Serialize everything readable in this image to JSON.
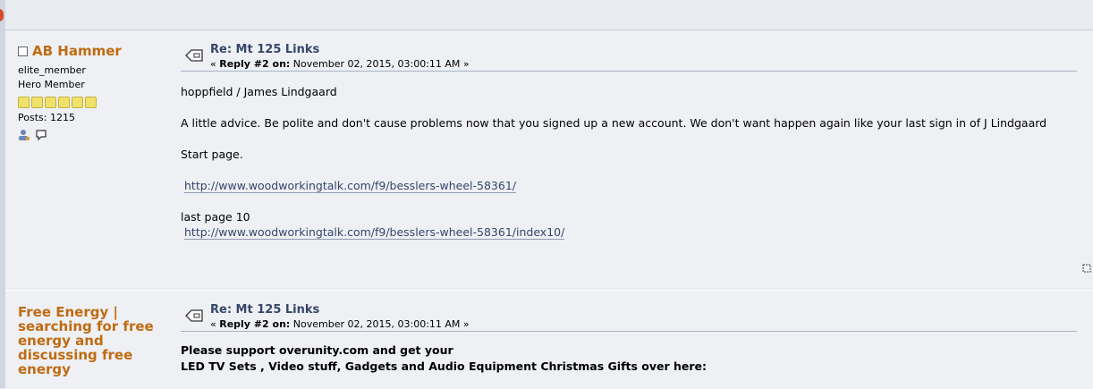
{
  "post1": {
    "username": "AB Hammer",
    "group": "elite_member",
    "rank": "Hero Member",
    "posts": "Posts: 1215",
    "title": "Re: Mt 125 Links",
    "reply_label": "Reply #2 on:",
    "reply_prefix": "«",
    "reply_suffix": "»",
    "date": "November 02, 2015, 03:00:11 AM",
    "line1": "hoppfield / James Lindgaard",
    "line2": "A little advice. Be polite and don't cause problems now that you signed up a new account. We don't want happen again like your last sign in of J Lindgaard",
    "line3": "Start page.",
    "link1": "http://www.woodworkingtalk.com/f9/besslers-wheel-58361/",
    "line4": "last page 10",
    "link2": "http://www.woodworkingtalk.com/f9/besslers-wheel-58361/index10/"
  },
  "post2": {
    "username": "Free Energy | searching for free energy and discussing free energy",
    "title": "Re: Mt 125 Links",
    "reply_label": "Reply #2 on:",
    "reply_prefix": "«",
    "reply_suffix": "»",
    "date": "November 02, 2015, 03:00:11 AM",
    "bold1": "Please support overunity.com and get your",
    "bold2": "LED TV Sets , Video stuff, Gadgets and Audio Equipment Christmas Gifts over here:"
  },
  "icons": [
    "profile-icon",
    "message-icon",
    "post-icon",
    "report-icon"
  ],
  "colors": {
    "username": "#c06b11",
    "title": "#35466a",
    "background": "#eef0f4"
  }
}
